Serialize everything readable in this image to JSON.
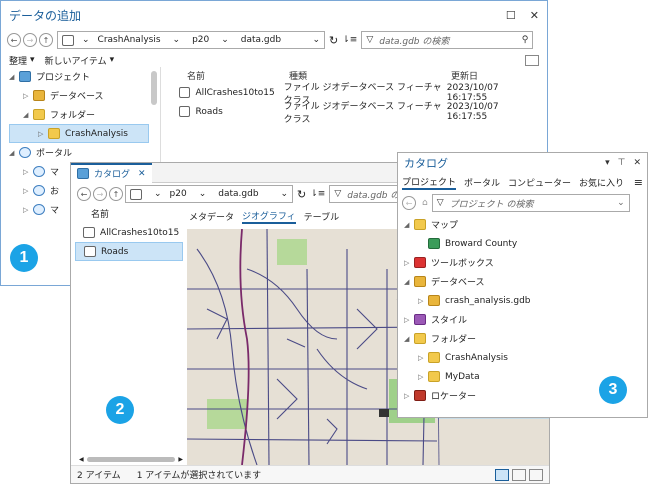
{
  "w1": {
    "title": "データの追加",
    "breadcrumb": [
      "CrashAnalysis",
      "p20",
      "data.gdb"
    ],
    "search_placeholder": "data.gdb の検索",
    "menu": [
      "整理",
      "新しいアイテム"
    ],
    "tree": [
      "プロジェクト",
      "データベース",
      "フォルダー",
      "CrashAnalysis",
      "ポータル",
      "マ",
      "お",
      "マ"
    ],
    "columns": [
      "名前",
      "種類",
      "更新日"
    ],
    "rows": [
      {
        "name": "AllCrashes10to15",
        "type": "ファイル ジオデータベース フィーチャクラス",
        "date": "2023/10/07 16:17:55"
      },
      {
        "name": "Roads",
        "type": "ファイル ジオデータベース フィーチャクラス",
        "date": "2023/10/07 16:17:55"
      }
    ]
  },
  "w2": {
    "tab": "カタログ",
    "breadcrumb": [
      "p20",
      "data.gdb"
    ],
    "search_placeholder": "data.gdb の検索",
    "list_header": "名前",
    "items": [
      "AllCrashes10to15",
      "Roads"
    ],
    "view_tabs": [
      "メタデータ",
      "ジオグラフィ",
      "テーブル"
    ],
    "status": [
      "2 アイテム",
      "1 アイテムが選択されています"
    ]
  },
  "w3": {
    "title": "カタログ",
    "tabs": [
      "プロジェクト",
      "ポータル",
      "コンピューター",
      "お気に入り"
    ],
    "search_placeholder": "プロジェクト の検索",
    "tree": [
      "マップ",
      "Broward County",
      "ツールボックス",
      "データベース",
      "crash_analysis.gdb",
      "スタイル",
      "フォルダー",
      "CrashAnalysis",
      "MyData",
      "ロケーター"
    ]
  },
  "badges": [
    "1",
    "2",
    "3"
  ],
  "colors": {
    "accent": "#1ba3e6",
    "title_blue": "#1a5e9a",
    "selection": "#cce4f7"
  }
}
